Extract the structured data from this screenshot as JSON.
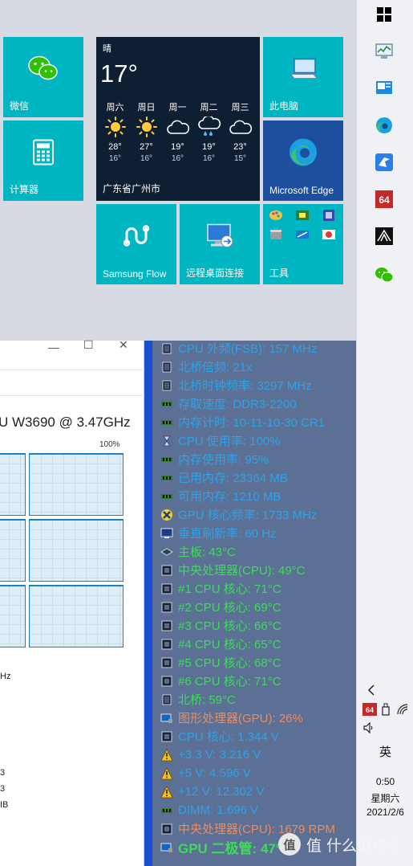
{
  "start_menu": {
    "tiles": {
      "wechat": "微信",
      "calculator": "计算器",
      "this_pc": "此电脑",
      "edge": "Microsoft Edge",
      "samsung_flow": "Samsung Flow",
      "remote_desktop": "远程桌面连接",
      "tools": "工具"
    },
    "weather": {
      "condition": "晴",
      "temperature": "17°",
      "location": "广东省广州市",
      "days": [
        {
          "name": "周六",
          "icon": "sun-icon",
          "high": "28°",
          "low": "16°"
        },
        {
          "name": "周日",
          "icon": "sun-icon",
          "high": "27°",
          "low": "16°"
        },
        {
          "name": "周一",
          "icon": "cloud-icon",
          "high": "19°",
          "low": "16°"
        },
        {
          "name": "周二",
          "icon": "rain-cloud-icon",
          "high": "19°",
          "low": "16°"
        },
        {
          "name": "周三",
          "icon": "cloud-icon",
          "high": "23°",
          "low": "15°"
        }
      ]
    }
  },
  "task_manager": {
    "cpu_name": "U W3690 @ 3.47GHz",
    "graph_max": "100%",
    "utilization": 1.0,
    "side_labels": [
      "Hz",
      "3",
      "3",
      "IB"
    ]
  },
  "sensor_panel": {
    "rows": [
      {
        "text": "CPU 外频(FSB): 157 MHz",
        "color": "#2fa3e8",
        "icon": "chip-icon"
      },
      {
        "text": "北桥倍频: 21x",
        "color": "#2fa3e8",
        "icon": "chip-icon"
      },
      {
        "text": "北桥时钟频率: 3297 MHz",
        "color": "#2fa3e8",
        "icon": "chip-icon"
      },
      {
        "text": "存取速度: DDR3-2200",
        "color": "#2fa3e8",
        "icon": "ram-icon"
      },
      {
        "text": "内存计时: 10-11-10-30 CR1",
        "color": "#2fa3e8",
        "icon": "ram-icon"
      },
      {
        "text": "CPU 使用率: 100%",
        "color": "#2fa3e8",
        "icon": "hourglass-icon"
      },
      {
        "text": "内存使用率: 95%",
        "color": "#2fa3e8",
        "icon": "ram-icon"
      },
      {
        "text": "已用内存: 23364 MB",
        "color": "#2fa3e8",
        "icon": "ram-icon"
      },
      {
        "text": "可用内存: 1210 MB",
        "color": "#2fa3e8",
        "icon": "ram-icon"
      },
      {
        "text": "GPU 核心频率: 1733 MHz",
        "color": "#2fa3e8",
        "icon": "xbox-icon"
      },
      {
        "text": "垂直刷新率: 60 Hz",
        "color": "#2fa3e8",
        "icon": "monitor-icon"
      },
      {
        "text": "主板: 43°C",
        "color": "#3ddc5a",
        "icon": "board-icon"
      },
      {
        "text": "中央处理器(CPU): 49°C",
        "color": "#3ddc5a",
        "icon": "cpu-icon"
      },
      {
        "text": " #1 CPU 核心: 71°C",
        "color": "#3ddc5a",
        "icon": "cpu-icon"
      },
      {
        "text": " #2 CPU 核心: 69°C",
        "color": "#3ddc5a",
        "icon": "cpu-icon"
      },
      {
        "text": " #3 CPU 核心: 66°C",
        "color": "#3ddc5a",
        "icon": "cpu-icon"
      },
      {
        "text": " #4 CPU 核心: 65°C",
        "color": "#3ddc5a",
        "icon": "cpu-icon"
      },
      {
        "text": " #5 CPU 核心: 68°C",
        "color": "#3ddc5a",
        "icon": "cpu-icon"
      },
      {
        "text": " #6 CPU 核心: 71°C",
        "color": "#3ddc5a",
        "icon": "cpu-icon"
      },
      {
        "text": "北桥: 59°C",
        "color": "#3ddc5a",
        "icon": "chip-icon"
      },
      {
        "text": "图形处理器(GPU): 26%",
        "color": "#ef8b5f",
        "icon": "gpu-icon"
      },
      {
        "text": "CPU 核心: 1.344 V",
        "color": "#2fa3e8",
        "icon": "cpu-icon"
      },
      {
        "text": "+3.3 V: 3.216 V",
        "color": "#2fa3e8",
        "icon": "warning-icon"
      },
      {
        "text": "+5 V: 4.596 V",
        "color": "#2fa3e8",
        "icon": "warning-icon"
      },
      {
        "text": "+12 V: 12.302 V",
        "color": "#2fa3e8",
        "icon": "warning-icon"
      },
      {
        "text": "DIMM: 1.696 V",
        "color": "#2fa3e8",
        "icon": "ram-icon"
      },
      {
        "text": "中央处理器(CPU): 1679 RPM",
        "color": "#ef8b5f",
        "icon": "cpu-icon"
      },
      {
        "text": "GPU 二极管: 47°C",
        "color": "#3ddc5a",
        "icon": "gpu-icon"
      }
    ]
  },
  "taskbar": {
    "tray": {
      "input_method": "英",
      "time": "0:50",
      "weekday": "星期六",
      "date": "2021/2/6"
    }
  },
  "watermark": "值 什么值得买",
  "colors": {
    "tile_teal": "#00b6c2",
    "sensor_bg": "#5c6f95",
    "sensor_stripe": "#1a4fcf",
    "value_blue": "#2fa3e8",
    "value_green": "#3ddc5a",
    "value_orange": "#ef8b5f"
  }
}
